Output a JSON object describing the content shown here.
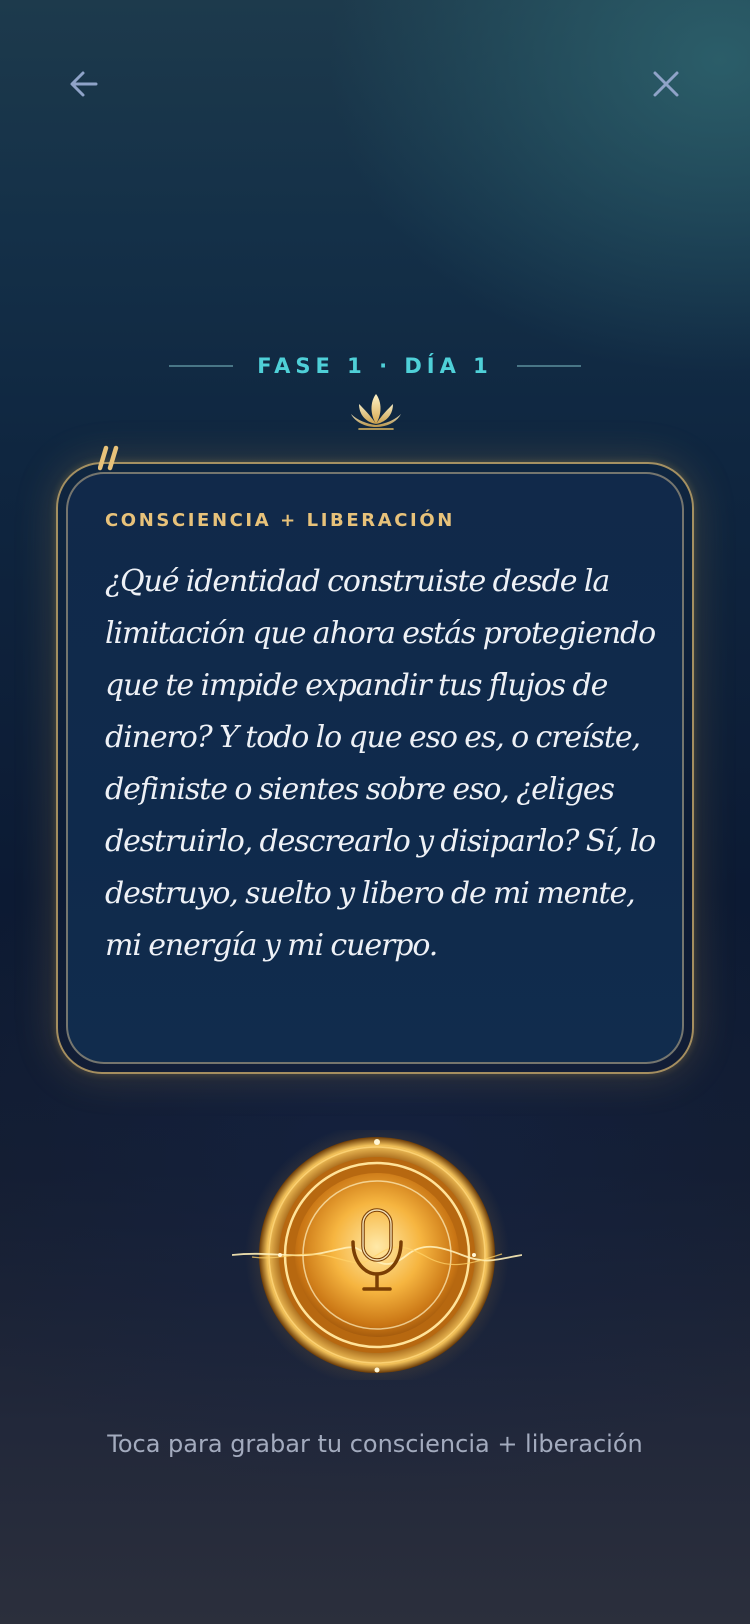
{
  "nav": {
    "back_icon": "arrow-left-icon",
    "close_icon": "close-icon"
  },
  "phase": {
    "label": "FASE 1 · DÍA 1",
    "ornament_icon": "lotus-icon"
  },
  "card": {
    "quote_icon": "quote-icon",
    "category": "CONSCIENCIA + LIBERACIÓN",
    "prompt": "¿Qué identidad construiste desde la limitación que ahora estás protegiendo que te impide expandir tus flujos de dinero? Y todo lo que eso es, o creíste, definiste o sientes sobre eso, ¿eliges destruirlo, descrearlo y disiparlo? Sí, lo destruyo, suelto y libero de mi mente, mi energía y mi cuerpo."
  },
  "record": {
    "icon": "microphone-icon",
    "hint": "Toca para grabar tu consciencia + liberación"
  },
  "colors": {
    "accent_teal": "#4fd0d8",
    "accent_gold": "#e8c27a",
    "card_bg": "#0f2a4c",
    "text": "#eef1f6",
    "muted": "#a3abbe"
  }
}
